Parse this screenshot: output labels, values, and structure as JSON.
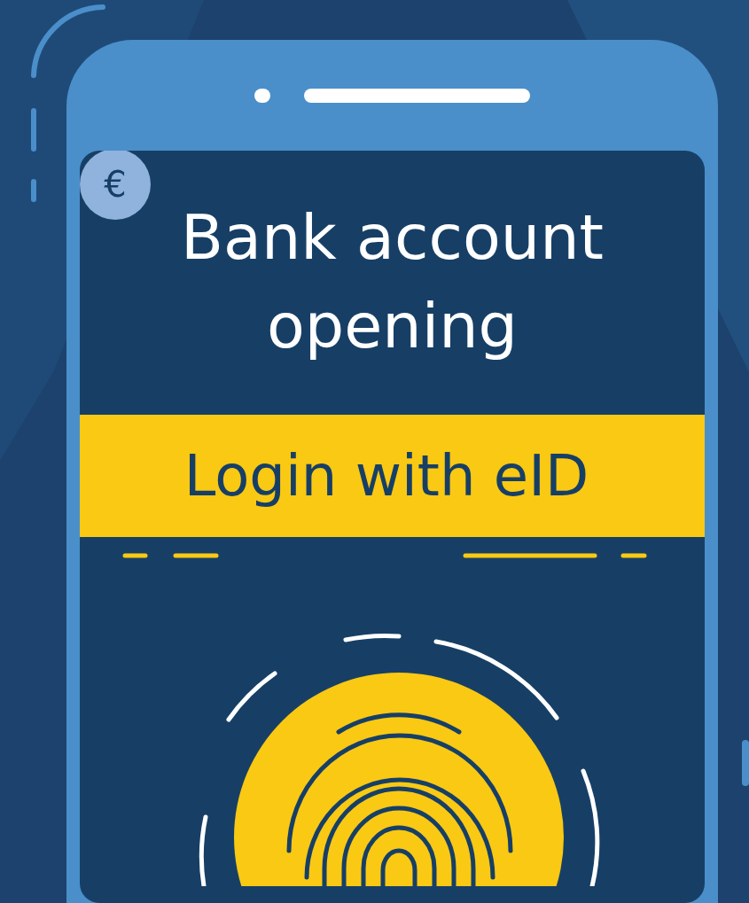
{
  "screen": {
    "badge": "€",
    "title": "Bank account opening",
    "button": {
      "label": "Login with eID"
    }
  }
}
